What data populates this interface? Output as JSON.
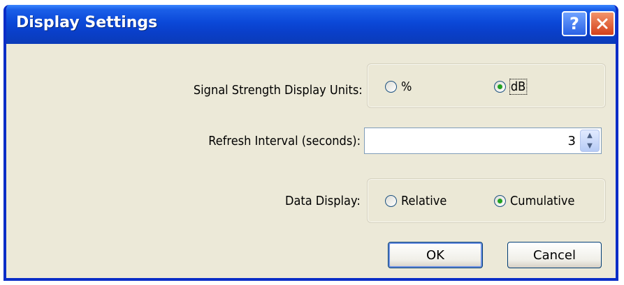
{
  "window": {
    "title": "Display Settings"
  },
  "title_buttons": {
    "help": "?",
    "close": "close"
  },
  "signal_strength": {
    "label": "Signal Strength Display Units:",
    "options": [
      {
        "label": "%",
        "selected": false
      },
      {
        "label": "dB",
        "selected": true
      }
    ]
  },
  "refresh_interval": {
    "label": "Refresh Interval (seconds):",
    "value": "3"
  },
  "data_display": {
    "label": "Data Display:",
    "options": [
      {
        "label": "Relative",
        "selected": false
      },
      {
        "label": "Cumulative",
        "selected": true
      }
    ]
  },
  "buttons": {
    "ok": "OK",
    "cancel": "Cancel"
  },
  "colors": {
    "titlebar": "#0b48d8",
    "dialog_bg": "#ece9d8",
    "radio_dot": "#21a121"
  }
}
